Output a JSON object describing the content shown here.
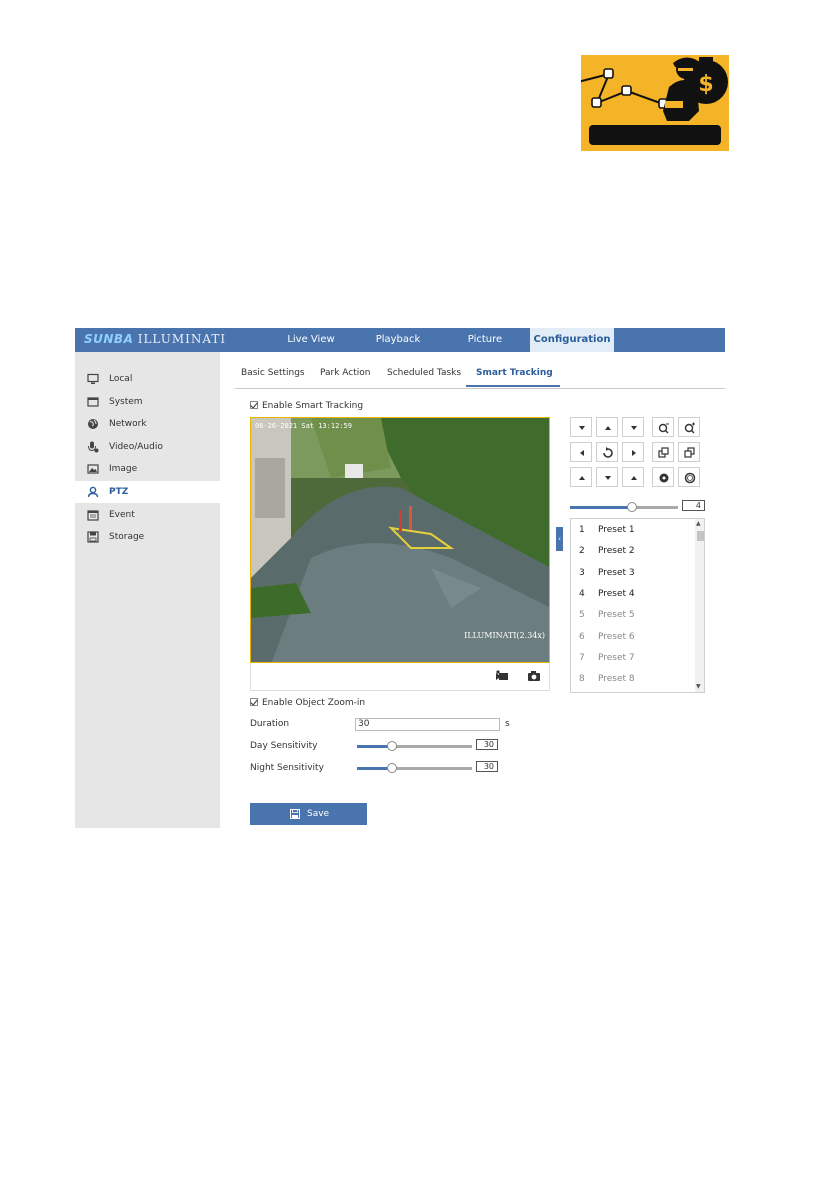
{
  "app": {
    "brand_main": "SUNBA",
    "brand_sub": "ILLUMINATI",
    "nav": [
      {
        "label": "Live View"
      },
      {
        "label": "Playback"
      },
      {
        "label": "Picture"
      },
      {
        "label": "Configuration",
        "active": true
      }
    ]
  },
  "sidebar": {
    "items": [
      {
        "label": "Local",
        "icon": "monitor-icon"
      },
      {
        "label": "System",
        "icon": "window-icon"
      },
      {
        "label": "Network",
        "icon": "globe-icon"
      },
      {
        "label": "Video/Audio",
        "icon": "microphone-icon"
      },
      {
        "label": "Image",
        "icon": "image-icon"
      },
      {
        "label": "PTZ",
        "icon": "user-icon",
        "active": true
      },
      {
        "label": "Event",
        "icon": "calendar-icon"
      },
      {
        "label": "Storage",
        "icon": "disk-icon"
      }
    ]
  },
  "tabs": [
    {
      "label": "Basic Settings"
    },
    {
      "label": "Park Action"
    },
    {
      "label": "Scheduled Tasks"
    },
    {
      "label": "Smart Tracking",
      "active": true
    }
  ],
  "smart_tracking": {
    "enable_label": "Enable Smart Tracking",
    "enable_checked": true,
    "video": {
      "timestamp": "06-26-2021 Sat 13:12:59",
      "osd": "ILLUMINATI(2.34x)",
      "record_icon": "video-record-icon",
      "capture_icon": "camera-capture-icon"
    },
    "zoom_enable_label": "Enable Object Zoom-in",
    "zoom_enable_checked": true,
    "duration_label": "Duration",
    "duration_value": "30",
    "duration_unit": "s",
    "day_sensitivity_label": "Day Sensitivity",
    "day_sensitivity_value": "30",
    "day_sensitivity_level": 30,
    "night_sensitivity_label": "Night Sensitivity",
    "night_sensitivity_value": "30",
    "night_sensitivity_level": 30,
    "save_label": "Save",
    "save_icon": "floppy-disk-icon"
  },
  "ptz": {
    "speed_value": "4",
    "speed_level": 4,
    "speed_max": 7,
    "presets": [
      {
        "num": "1",
        "name": "Preset 1",
        "set": true
      },
      {
        "num": "2",
        "name": "Preset 2",
        "set": true
      },
      {
        "num": "3",
        "name": "Preset 3",
        "set": true
      },
      {
        "num": "4",
        "name": "Preset 4",
        "set": true
      },
      {
        "num": "5",
        "name": "Preset 5",
        "set": false
      },
      {
        "num": "6",
        "name": "Preset 6",
        "set": false
      },
      {
        "num": "7",
        "name": "Preset 7",
        "set": false
      },
      {
        "num": "8",
        "name": "Preset 8",
        "set": false
      }
    ]
  },
  "colors": {
    "accent": "#4a74ae",
    "badge": "#f5b427",
    "video_border": "#e6b800"
  }
}
